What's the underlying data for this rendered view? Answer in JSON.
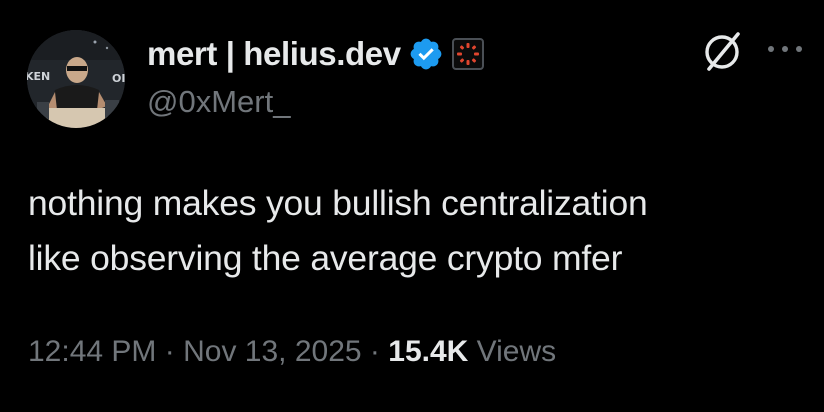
{
  "author": {
    "display_name": "mert | helius.dev",
    "handle": "@0xMert_",
    "verified_icon": "verified-badge-icon",
    "affiliate_icon": "affiliate-badge-icon"
  },
  "actions": {
    "grok_icon": "grok-icon",
    "more_icon": "more-icon"
  },
  "tweet": {
    "lines": [
      "nothing makes you bullish centralization",
      "like observing the average crypto mfer"
    ]
  },
  "meta": {
    "time": "12:44 PM",
    "separator": "·",
    "date": "Nov 13, 2025",
    "views_count": "15.4K",
    "views_label": "Views"
  },
  "colors": {
    "background": "#000000",
    "text_primary": "#e7e9ea",
    "text_secondary": "#71767b",
    "verified_blue": "#1d9bf0",
    "affiliate_red": "#e0452e"
  }
}
